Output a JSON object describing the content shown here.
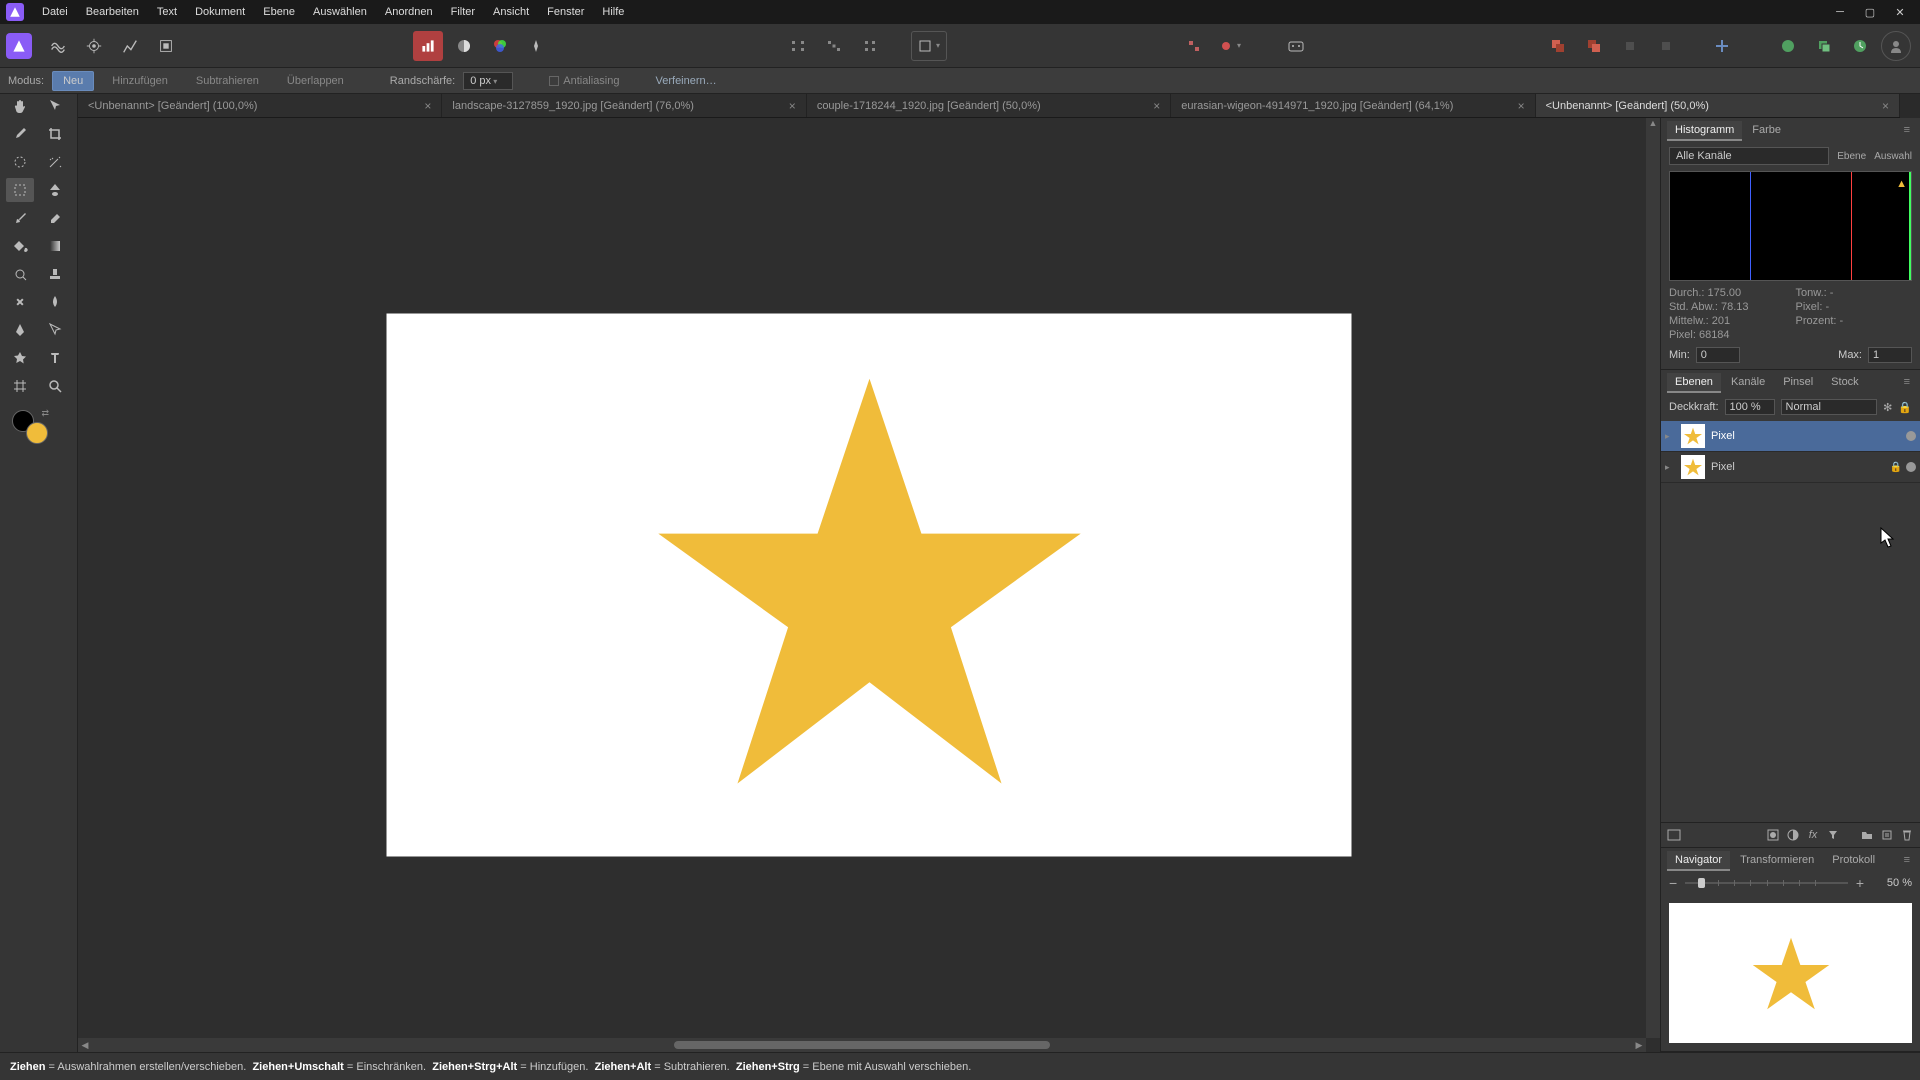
{
  "menus": [
    "Datei",
    "Bearbeiten",
    "Text",
    "Dokument",
    "Ebene",
    "Auswählen",
    "Anordnen",
    "Filter",
    "Ansicht",
    "Fenster",
    "Hilfe"
  ],
  "context": {
    "modus_label": "Modus:",
    "modes": [
      "Neu",
      "Hinzufügen",
      "Subtrahieren",
      "Überlappen"
    ],
    "active_mode": 0,
    "feather_label": "Randschärfe:",
    "feather_value": "0 px",
    "antialias": "Antialiasing",
    "refine": "Verfeinern…"
  },
  "tabs": [
    {
      "label": "<Unbenannt> [Geändert] (100,0%)"
    },
    {
      "label": "landscape-3127859_1920.jpg [Geändert] (76,0%)"
    },
    {
      "label": "couple-1718244_1920.jpg [Geändert] (50,0%)"
    },
    {
      "label": "eurasian-wigeon-4914971_1920.jpg [Geändert] (64,1%)"
    },
    {
      "label": "<Unbenannt> [Geändert] (50,0%)"
    }
  ],
  "active_tab": 4,
  "right": {
    "hist": {
      "tabs": [
        "Histogramm",
        "Farbe"
      ],
      "channels": "Alle Kanäle",
      "scope_layer": "Ebene",
      "scope_sel": "Auswahl",
      "stats": {
        "durch": "Durch.: 175.00",
        "std": "Std. Abw.: 78.13",
        "mittel": "Mittelw.: 201",
        "pixel": "Pixel: 68184",
        "tonw": "Tonw.: -",
        "anz": "Pixel: -",
        "proz": "Prozent: -"
      },
      "min_label": "Min:",
      "min": "0",
      "max_label": "Max:",
      "max": "1"
    },
    "layers": {
      "tabs": [
        "Ebenen",
        "Kanäle",
        "Pinsel",
        "Stock"
      ],
      "opacity_label": "Deckkraft:",
      "opacity": "100 %",
      "blend": "Normal",
      "items": [
        {
          "name": "Pixel",
          "active": true
        },
        {
          "name": "Pixel",
          "active": false,
          "locked": true
        }
      ]
    },
    "nav": {
      "tabs": [
        "Navigator",
        "Transformieren",
        "Protokoll"
      ],
      "zoom": "50 %"
    }
  },
  "status": {
    "k1": "Ziehen",
    "v1": "Auswahlrahmen erstellen/verschieben.",
    "k2": "Ziehen+Umschalt",
    "v2": "Einschränken.",
    "k3": "Ziehen+Strg+Alt",
    "v3": "Hinzufügen.",
    "k4": "Ziehen+Alt",
    "v4": "Subtrahieren.",
    "k5": "Ziehen+Strg",
    "v5": "Ebene mit Auswahl verschieben."
  },
  "colors": {
    "star": "#f0bc3a",
    "accent": "#4a6a9a"
  }
}
